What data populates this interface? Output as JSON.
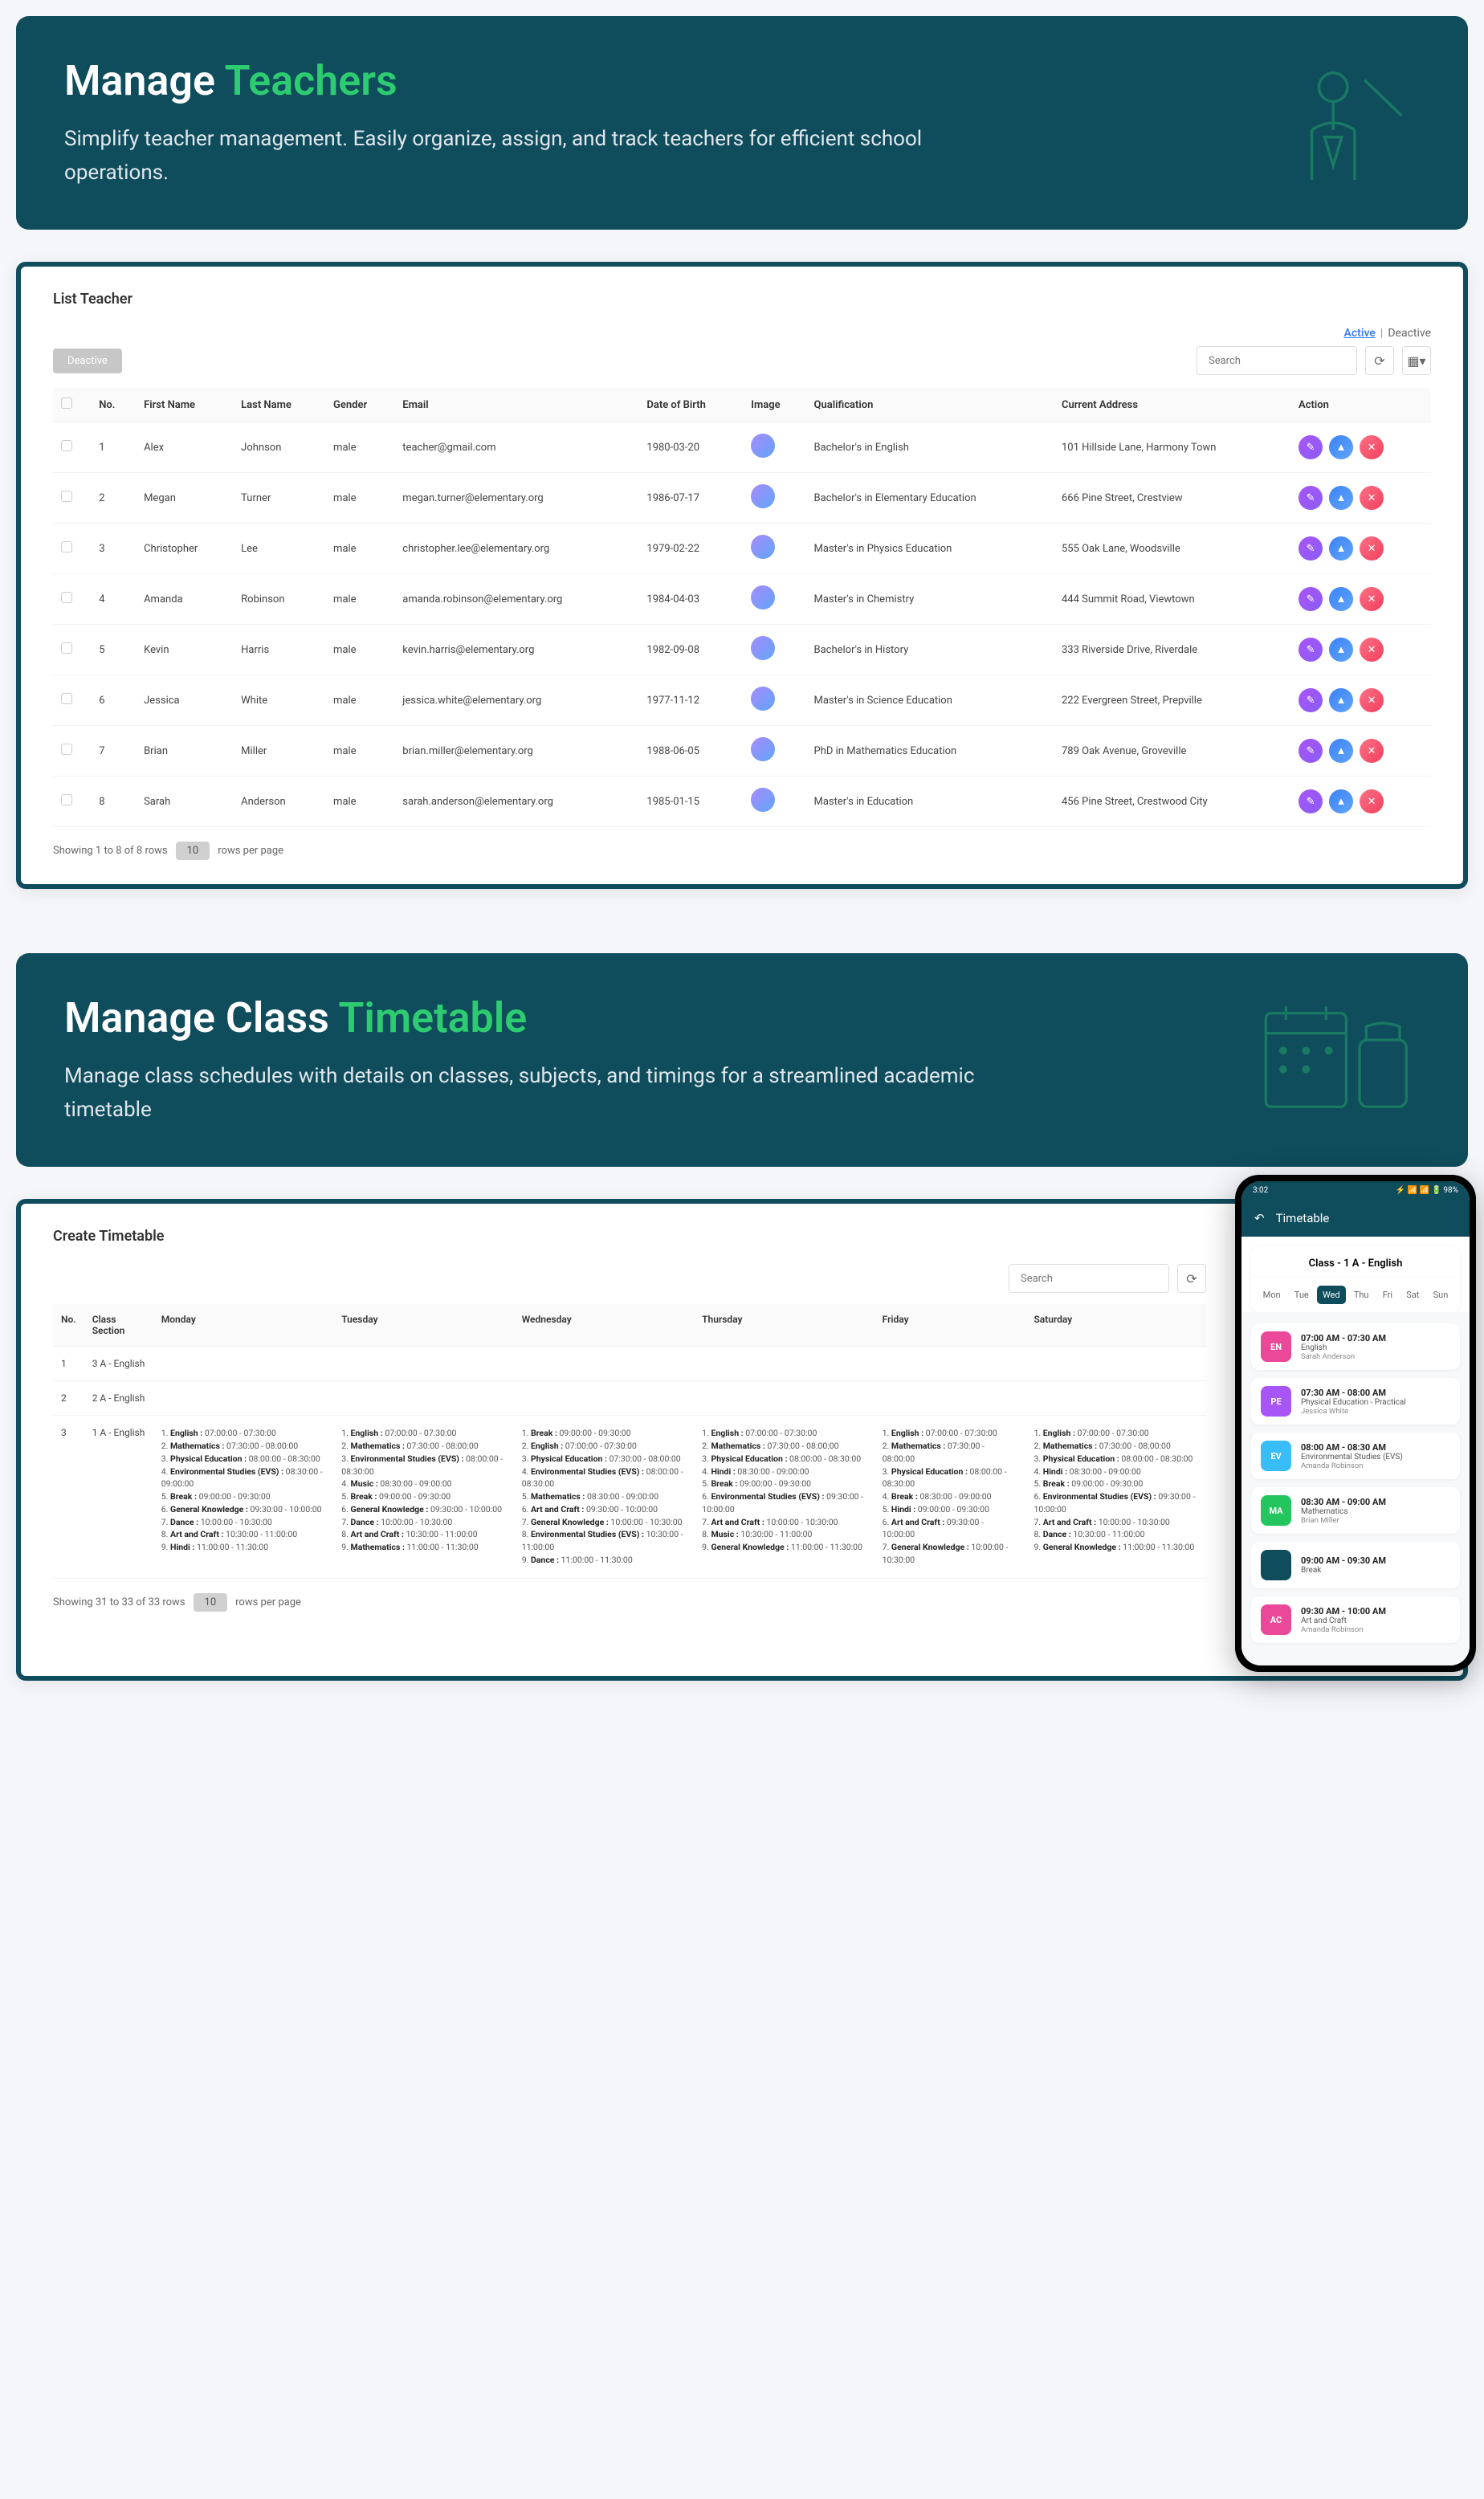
{
  "hero1": {
    "prefix": "Manage",
    "accent": "Teachers",
    "desc": "Simplify teacher management. Easily organize, assign, and track teachers for efficient school operations."
  },
  "teacherCard": {
    "title": "List Teacher",
    "deactiveBtn": "Deactive",
    "tabs": {
      "active": "Active",
      "sep": "|",
      "deactive": "Deactive"
    },
    "searchPh": "Search",
    "cols": [
      "",
      "No.",
      "First Name",
      "Last Name",
      "Gender",
      "Email",
      "Date of Birth",
      "Image",
      "Qualification",
      "Current Address",
      "Action"
    ],
    "rows": [
      {
        "no": "1",
        "fn": "Alex",
        "ln": "Johnson",
        "g": "male",
        "em": "teacher@gmail.com",
        "dob": "1980-03-20",
        "q": "Bachelor's in English",
        "addr": "101 Hillside Lane, Harmony Town"
      },
      {
        "no": "2",
        "fn": "Megan",
        "ln": "Turner",
        "g": "male",
        "em": "megan.turner@elementary.org",
        "dob": "1986-07-17",
        "q": "Bachelor's in Elementary Education",
        "addr": "666 Pine Street, Crestview"
      },
      {
        "no": "3",
        "fn": "Christopher",
        "ln": "Lee",
        "g": "male",
        "em": "christopher.lee@elementary.org",
        "dob": "1979-02-22",
        "q": "Master's in Physics Education",
        "addr": "555 Oak Lane, Woodsville"
      },
      {
        "no": "4",
        "fn": "Amanda",
        "ln": "Robinson",
        "g": "male",
        "em": "amanda.robinson@elementary.org",
        "dob": "1984-04-03",
        "q": "Master's in Chemistry",
        "addr": "444 Summit Road, Viewtown"
      },
      {
        "no": "5",
        "fn": "Kevin",
        "ln": "Harris",
        "g": "male",
        "em": "kevin.harris@elementary.org",
        "dob": "1982-09-08",
        "q": "Bachelor's in History",
        "addr": "333 Riverside Drive, Riverdale"
      },
      {
        "no": "6",
        "fn": "Jessica",
        "ln": "White",
        "g": "male",
        "em": "jessica.white@elementary.org",
        "dob": "1977-11-12",
        "q": "Master's in Science Education",
        "addr": "222 Evergreen Street, Prepville"
      },
      {
        "no": "7",
        "fn": "Brian",
        "ln": "Miller",
        "g": "male",
        "em": "brian.miller@elementary.org",
        "dob": "1988-06-05",
        "q": "PhD in Mathematics Education",
        "addr": "789 Oak Avenue, Groveville"
      },
      {
        "no": "8",
        "fn": "Sarah",
        "ln": "Anderson",
        "g": "male",
        "em": "sarah.anderson@elementary.org",
        "dob": "1985-01-15",
        "q": "Master's in Education",
        "addr": "456 Pine Street, Crestwood City"
      }
    ],
    "pager": {
      "text": "Showing 1 to 8 of 8 rows",
      "count": "10",
      "suffix": "rows per page"
    }
  },
  "hero2": {
    "prefix": "Manage Class",
    "accent": "Timetable",
    "desc": "Manage class schedules with details on classes, subjects, and timings for a streamlined academic timetable"
  },
  "ttCard": {
    "title": "Create Timetable",
    "searchPh": "Search",
    "cols": [
      "No.",
      "Class Section",
      "Monday",
      "Tuesday",
      "Wednesday",
      "Thursday",
      "Friday",
      "Saturday"
    ],
    "rows": [
      {
        "no": "1",
        "cs": "3 A - English",
        "mon": "",
        "tue": "",
        "wed": "",
        "thu": "",
        "fri": "",
        "sat": ""
      },
      {
        "no": "2",
        "cs": "2 A - English",
        "mon": "",
        "tue": "",
        "wed": "",
        "thu": "",
        "fri": "",
        "sat": ""
      },
      {
        "no": "3",
        "cs": "1 A - English",
        "mon": "1. <b>English :</b> 07:00:00 - 07:30:00<br>2. <b>Mathematics :</b> 07:30:00 - 08:00:00<br>3. <b>Physical Education :</b> 08:00:00 - 08:30:00<br>4. <b>Environmental Studies (EVS) :</b> 08:30:00 - 09:00:00<br>5. <b>Break :</b> 09:00:00 - 09:30:00<br>6. <b>General Knowledge :</b> 09:30:00 - 10:00:00<br>7. <b>Dance :</b> 10:00:00 - 10:30:00<br>8. <b>Art and Craft :</b> 10:30:00 - 11:00:00<br>9. <b>Hindi :</b> 11:00:00 - 11:30:00",
        "tue": "1. <b>English :</b> 07:00:00 - 07:30:00<br>2. <b>Mathematics :</b> 07:30:00 - 08:00:00<br>3. <b>Environmental Studies (EVS) :</b> 08:00:00 - 08:30:00<br>4. <b>Music :</b> 08:30:00 - 09:00:00<br>5. <b>Break :</b> 09:00:00 - 09:30:00<br>6. <b>General Knowledge :</b> 09:30:00 - 10:00:00<br>7. <b>Dance :</b> 10:00:00 - 10:30:00<br>8. <b>Art and Craft :</b> 10:30:00 - 11:00:00<br>9. <b>Mathematics :</b> 11:00:00 - 11:30:00",
        "wed": "1. <b>Break :</b> 09:00:00 - 09:30:00<br>2. <b>English :</b> 07:00:00 - 07:30:00<br>3. <b>Physical Education :</b> 07:30:00 - 08:00:00<br>4. <b>Environmental Studies (EVS) :</b> 08:00:00 - 08:30:00<br>5. <b>Mathematics :</b> 08:30:00 - 09:00:00<br>6. <b>Art and Craft :</b> 09:30:00 - 10:00:00<br>7. <b>General Knowledge :</b> 10:00:00 - 10:30:00<br>8. <b>Environmental Studies (EVS) :</b> 10:30:00 - 11:00:00<br>9. <b>Dance :</b> 11:00:00 - 11:30:00",
        "thu": "1. <b>English :</b> 07:00:00 - 07:30:00<br>2. <b>Mathematics :</b> 07:30:00 - 08:00:00<br>3. <b>Physical Education :</b> 08:00:00 - 08:30:00<br>4. <b>Hindi :</b> 08:30:00 - 09:00:00<br>5. <b>Break :</b> 09:00:00 - 09:30:00<br>6. <b>Environmental Studies (EVS) :</b> 09:30:00 - 10:00:00<br>7. <b>Art and Craft :</b> 10:00:00 - 10:30:00<br>8. <b>Music :</b> 10:30:00 - 11:00:00<br>9. <b>General Knowledge :</b> 11:00:00 - 11:30:00",
        "fri": "1. <b>English :</b> 07:00:00 - 07:30:00<br>2. <b>Mathematics :</b> 07:30:00 - 08:00:00<br>3. <b>Physical Education :</b> 08:00:00 - 08:30:00<br>4. <b>Break :</b> 08:30:00 - 09:00:00<br>5. <b>Hindi :</b> 09:00:00 - 09:30:00<br>6. <b>Art and Craft :</b> 09:30:00 - 10:00:00<br>7. <b>General Knowledge :</b> 10:00:00 - 10:30:00",
        "sat": "1. <b>English :</b> 07:00:00 - 07:30:00<br>2. <b>Mathematics :</b> 07:30:00 - 08:00:00<br>3. <b>Physical Education :</b> 08:00:00 - 08:30:00<br>4. <b>Hindi :</b> 08:30:00 - 09:00:00<br>5. <b>Break :</b> 09:00:00 - 09:30:00<br>6. <b>Environmental Studies (EVS) :</b> 09:30:00 - 10:00:00<br>7. <b>Art and Craft :</b> 10:00:00 - 10:30:00<br>8. <b>Dance :</b> 10:30:00 - 11:00:00<br>9. <b>General Knowledge :</b> 11:00:00 - 11:30:00"
      }
    ],
    "pager": {
      "text": "Showing 31 to 33 of 33 rows",
      "count": "10",
      "suffix": "rows per page"
    }
  },
  "phone": {
    "time": "3:02",
    "status": "⚡ 📶 📶 🔋 98%",
    "title": "Timetable",
    "class": "Class - 1 A - English",
    "days": [
      "Mon",
      "Tue",
      "Wed",
      "Thu",
      "Fri",
      "Sat",
      "Sun"
    ],
    "selDay": "Wed",
    "slots": [
      {
        "color": "#ec4899",
        "code": "EN",
        "t": "07:00 AM - 07:30 AM",
        "s": "English",
        "n": "Sarah Anderson"
      },
      {
        "color": "#a855f7",
        "code": "PE",
        "t": "07:30 AM - 08:00 AM",
        "s": "Physical Education - Practical",
        "n": "Jessica White"
      },
      {
        "color": "#38bdf8",
        "code": "EV",
        "t": "08:00 AM - 08:30 AM",
        "s": "Environmental Studies (EVS)",
        "n": "Amanda Robinson"
      },
      {
        "color": "#22c55e",
        "code": "MA",
        "t": "08:30 AM - 09:00 AM",
        "s": "Mathematics",
        "n": "Brian Miller"
      },
      {
        "color": "#0f4c5c",
        "code": "",
        "t": "09:00 AM - 09:30 AM",
        "s": "Break",
        "n": ""
      },
      {
        "color": "#ec4899",
        "code": "AC",
        "t": "09:30 AM - 10:00 AM",
        "s": "Art and Craft",
        "n": "Amanda Robinson"
      }
    ]
  }
}
